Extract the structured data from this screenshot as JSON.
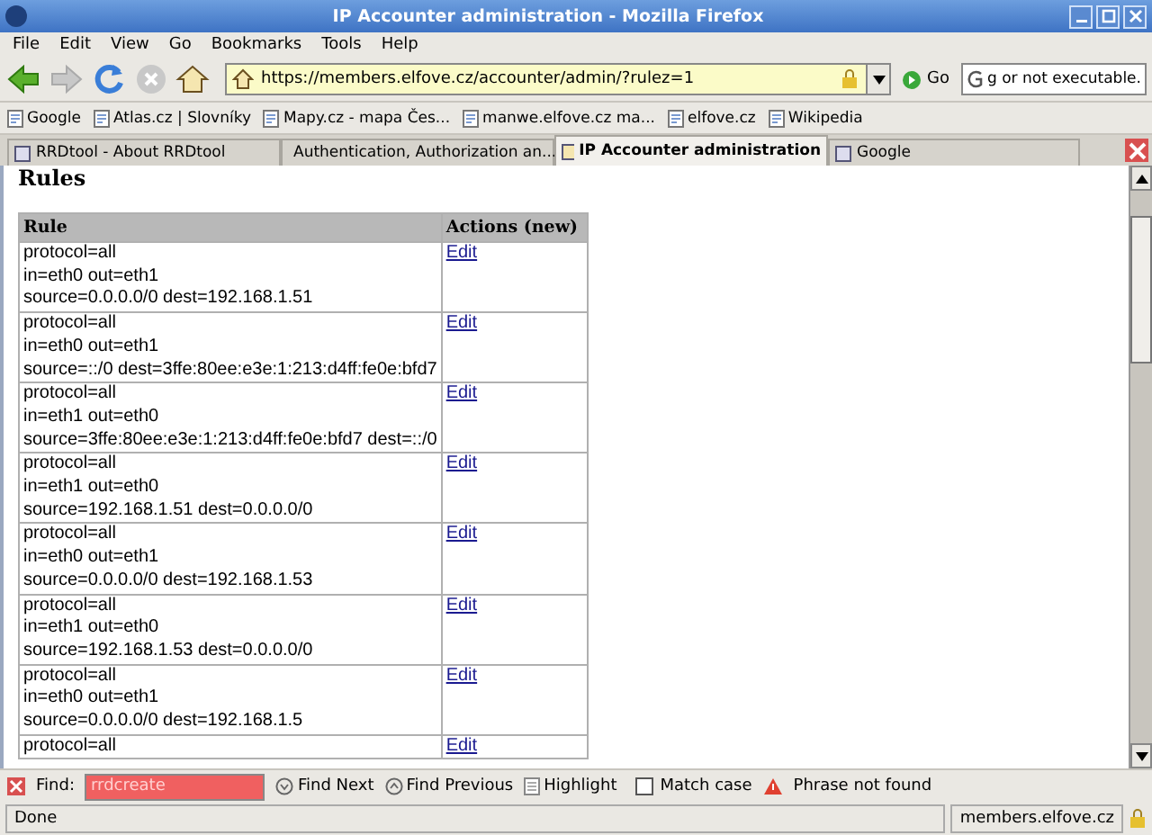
{
  "window": {
    "title": "IP Accounter administration - Mozilla Firefox"
  },
  "menu": [
    "File",
    "Edit",
    "View",
    "Go",
    "Bookmarks",
    "Tools",
    "Help"
  ],
  "toolbar": {
    "url": "https://members.elfove.cz/accounter/admin/?rulez=1",
    "go": "Go",
    "search_value": "g or not executable."
  },
  "bookmarks": [
    "Google",
    "Atlas.cz | Slovníky",
    "Mapy.cz - mapa Čes...",
    "manwe.elfove.cz ma...",
    "elfove.cz",
    "Wikipedia"
  ],
  "tabs": [
    {
      "label": "RRDtool - About RRDtool",
      "selected": false
    },
    {
      "label": "Authentication, Authorization an...",
      "selected": false
    },
    {
      "label": "IP Accounter administration",
      "selected": true
    },
    {
      "label": "Google",
      "selected": false
    }
  ],
  "page": {
    "heading": "Rules",
    "columns": [
      "Rule",
      "Actions (new)"
    ],
    "rows": [
      {
        "lines": [
          "protocol=all",
          "in=eth0 out=eth1",
          "source=0.0.0.0/0 dest=192.168.1.51"
        ],
        "action": "Edit"
      },
      {
        "lines": [
          "protocol=all",
          "in=eth0 out=eth1",
          "source=::/0 dest=3ffe:80ee:e3e:1:213:d4ff:fe0e:bfd7"
        ],
        "action": "Edit"
      },
      {
        "lines": [
          "protocol=all",
          "in=eth1 out=eth0",
          "source=3ffe:80ee:e3e:1:213:d4ff:fe0e:bfd7 dest=::/0"
        ],
        "action": "Edit"
      },
      {
        "lines": [
          "protocol=all",
          "in=eth1 out=eth0",
          "source=192.168.1.51 dest=0.0.0.0/0"
        ],
        "action": "Edit"
      },
      {
        "lines": [
          "protocol=all",
          "in=eth0 out=eth1",
          "source=0.0.0.0/0 dest=192.168.1.53"
        ],
        "action": "Edit"
      },
      {
        "lines": [
          "protocol=all",
          "in=eth1 out=eth0",
          "source=192.168.1.53 dest=0.0.0.0/0"
        ],
        "action": "Edit"
      },
      {
        "lines": [
          "protocol=all",
          "in=eth0 out=eth1",
          "source=0.0.0.0/0 dest=192.168.1.5"
        ],
        "action": "Edit"
      },
      {
        "lines": [
          "protocol=all"
        ],
        "action": "Edit"
      }
    ]
  },
  "find_bar": {
    "label": "Find:",
    "value": "rrdcreate",
    "not_found": true,
    "find_next": "Find Next",
    "find_previous": "Find Previous",
    "highlight": "Highlight",
    "match_case": {
      "label": "Match case",
      "checked": false
    },
    "message": "Phrase not found"
  },
  "status_bar": {
    "text": "Done",
    "host": "members.elfove.cz"
  }
}
